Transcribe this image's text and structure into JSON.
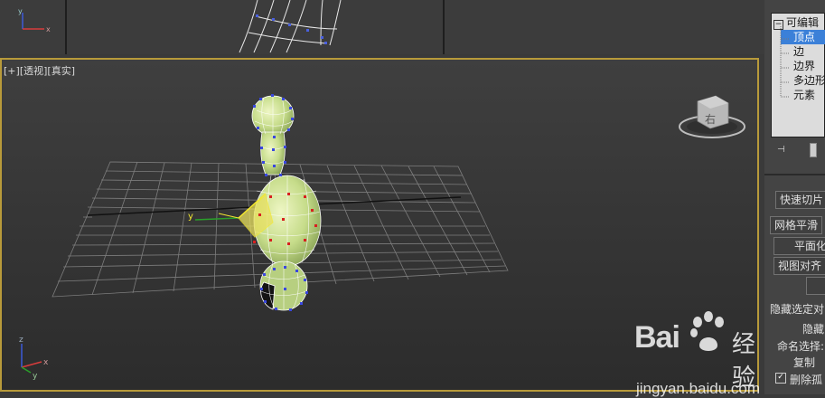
{
  "viewport": {
    "label_plus": "[+]",
    "label_view": "[透视]",
    "label_shade": "[真实]",
    "viewcube_face": "右",
    "axis_x": "x",
    "axis_y": "y",
    "axis_z": "z",
    "border_color": "#b89a3a"
  },
  "top_views": {
    "axis_x": "x",
    "axis_y": "y"
  },
  "modifier_stack": {
    "root": "可编辑",
    "items": [
      "顶点",
      "边",
      "边界",
      "多边形",
      "元素"
    ],
    "selected_index": 0
  },
  "panel": {
    "quick_slice": "快速切片",
    "mesh_smooth": "网格平滑",
    "planarize": "平面化",
    "view_align": "视图对齐",
    "hide_selected": "隐藏选定对",
    "hide_short": "隐藏",
    "named_sel": "命名选择:",
    "copy": "复制",
    "delete_iso": "删除孤"
  },
  "watermark": {
    "brand": "Bai",
    "brand2": "经验",
    "url": "jingyan.baidu.com"
  }
}
